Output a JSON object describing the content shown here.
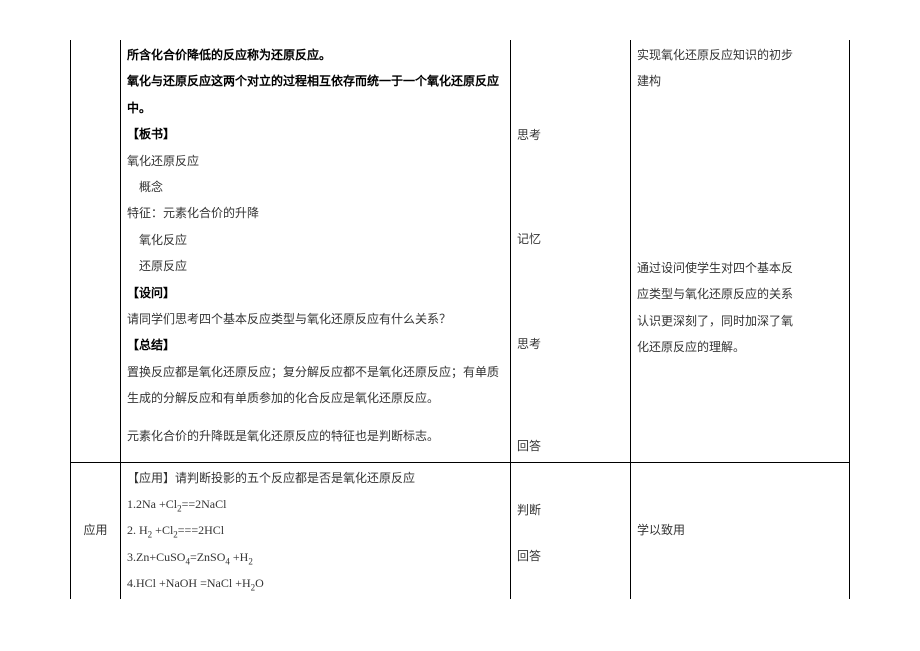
{
  "row1": {
    "label": "",
    "teacher": {
      "l1": "所含化合价降低的反应称为还原反应。",
      "l2": "氧化与还原反应这两个对立的过程相互依存而统一于一个氧化还原反应中。",
      "h1": "【板书】",
      "l3": "氧化还原反应",
      "l4": "概念",
      "l5": "特征：元素化合价的升降",
      "l6": "氧化反应",
      "l7": "还原反应",
      "h2": "【设问】",
      "l8": "请同学们思考四个基本反应类型与氧化还原反应有什么关系？",
      "h3": "【总结】",
      "l9": "置换反应都是氧化还原反应；复分解反应都不是氧化还原反应；有单质生成的分解反应和有单质参加的化合反应是氧化还原反应。",
      "l10": "元素化合价的升降既是氧化还原反应的特征也是判断标志。"
    },
    "student": {
      "s1": "思考",
      "s2": "记忆",
      "s3": "思考",
      "s4": "回答"
    },
    "intent": {
      "i1a": "实现氧化还原反应知识的初步",
      "i1b": "建构",
      "i2a": "通过设问使学生对四个基本反",
      "i2b": "应类型与氧化还原反应的关系",
      "i2c": "认识更深刻了，同时加深了氧",
      "i2d": "化还原反应的理解。"
    }
  },
  "row2": {
    "label": "应用",
    "teacher": {
      "h1": "【应用】请判断投影的五个反应都是否是氧化还原反应",
      "eq1_pre": "1.2Na +Cl",
      "eq1_sub1": "2",
      "eq1_post": "==2NaCl",
      "eq2_pre": "2. H",
      "eq2_sub1": "2",
      "eq2_mid": " +Cl",
      "eq2_sub2": "2",
      "eq2_post": "===2HCl",
      "eq3_pre": "3.Zn+CuSO",
      "eq3_sub1": "4",
      "eq3_mid": "=ZnSO",
      "eq3_sub2": "4",
      "eq3_mid2": " +H",
      "eq3_sub3": "2",
      "eq4_pre": "4.HCl +NaOH =NaCl +H",
      "eq4_sub1": "2",
      "eq4_post": "O"
    },
    "student": {
      "s1": "判断",
      "s2": "回答"
    },
    "intent": {
      "i1": "学以致用"
    }
  }
}
